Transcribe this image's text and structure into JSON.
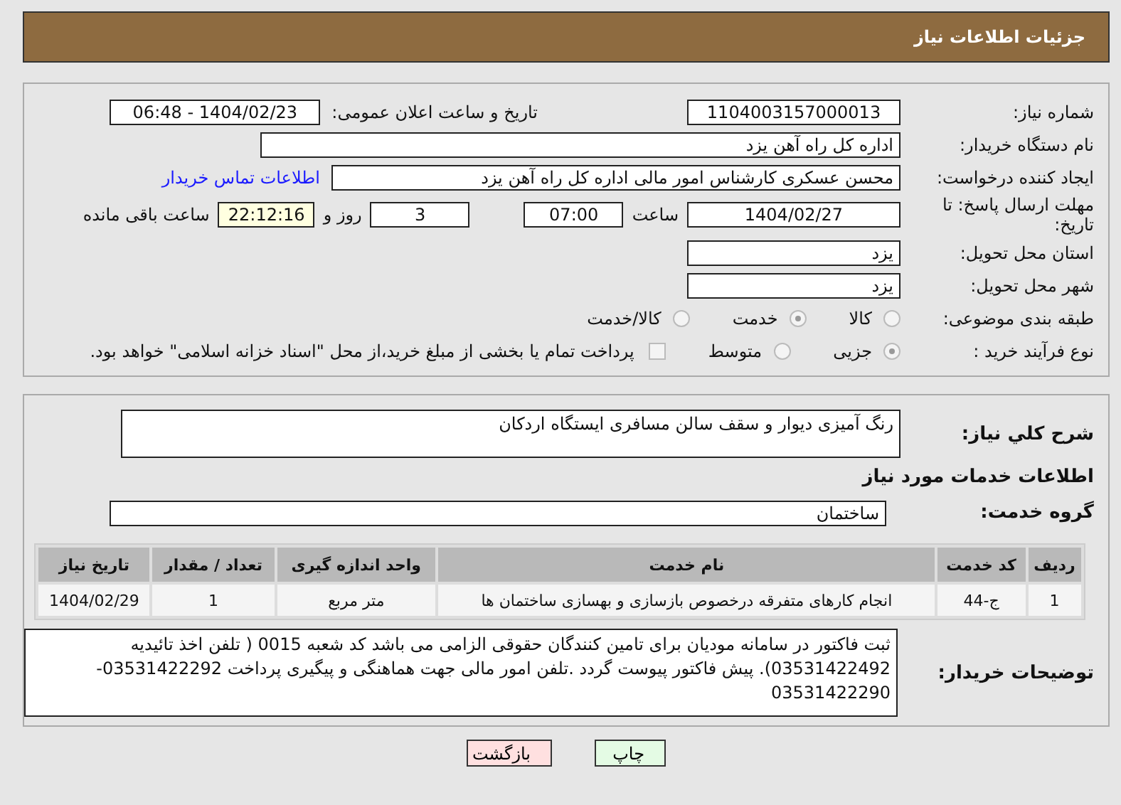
{
  "header": {
    "title": "جزئیات اطلاعات نیاز"
  },
  "need_number": {
    "label": "شماره نیاز:",
    "value": "1104003157000013"
  },
  "announce": {
    "label": "تاریخ و ساعت اعلان عمومی:",
    "value": "1404/02/23 - 06:48"
  },
  "buyer_org": {
    "label": "نام دستگاه خریدار:",
    "value": "اداره کل راه آهن یزد"
  },
  "requester": {
    "label": "ایجاد کننده درخواست:",
    "value": "محسن عسکری کارشناس امور مالی اداره کل راه آهن یزد",
    "link": "اطلاعات تماس خریدار"
  },
  "deadline": {
    "label": "مهلت ارسال پاسخ: تا تاریخ:",
    "date": "1404/02/27",
    "time_label": "ساعت",
    "time": "07:00",
    "days": "3",
    "days_label": "روز و",
    "remaining": "22:12:16",
    "remaining_label": "ساعت باقی مانده"
  },
  "province": {
    "label": "استان محل تحویل:",
    "value": "یزد"
  },
  "city": {
    "label": "شهر محل تحویل:",
    "value": "یزد"
  },
  "category": {
    "label": "طبقه بندی موضوعی:",
    "options": [
      {
        "label": "کالا",
        "selected": false
      },
      {
        "label": "خدمت",
        "selected": true
      },
      {
        "label": "کالا/خدمت",
        "selected": false
      }
    ]
  },
  "purchase_type": {
    "label": "نوع فرآیند خرید :",
    "options": [
      {
        "label": "جزیی",
        "selected": true
      },
      {
        "label": "متوسط",
        "selected": false
      }
    ],
    "payment": {
      "label": "پرداخت تمام یا بخشی از مبلغ خرید،از محل \"اسناد خزانه اسلامی\" خواهد بود.",
      "checked": false
    }
  },
  "description": {
    "label": "شرح كلي نياز:",
    "value": "رنگ آمیزی دیوار و سقف سالن مسافری ایستگاه اردکان"
  },
  "services_heading": "اطلاعات خدمات مورد نیاز",
  "service_group": {
    "label": "گروه خدمت:",
    "value": "ساختمان"
  },
  "table": {
    "columns": [
      "ردیف",
      "کد خدمت",
      "نام خدمت",
      "واحد اندازه گیری",
      "تعداد / مقدار",
      "تاریخ نیاز"
    ],
    "rows": [
      [
        "1",
        "ج-44",
        "انجام کارهای متفرقه درخصوص بازسازی و بهسازی ساختمان ها",
        "متر مربع",
        "1",
        "1404/02/29"
      ]
    ]
  },
  "buyer_notes": {
    "label": "توضیحات خریدار:",
    "value": "ثبت فاکتور در سامانه مودیان برای تامین کنندگان حقوقی الزامی می باشد کد شعبه 0015 ( تلفن اخذ تائیدیه 03531422492). پیش فاکتور پیوست گردد .تلفن امور مالی جهت هماهنگی و پیگیری پرداخت 03531422292- 03531422290"
  },
  "buttons": [
    {
      "label": "چاپ",
      "kind": "print"
    },
    {
      "label": "بازگشت",
      "kind": "back"
    }
  ]
}
